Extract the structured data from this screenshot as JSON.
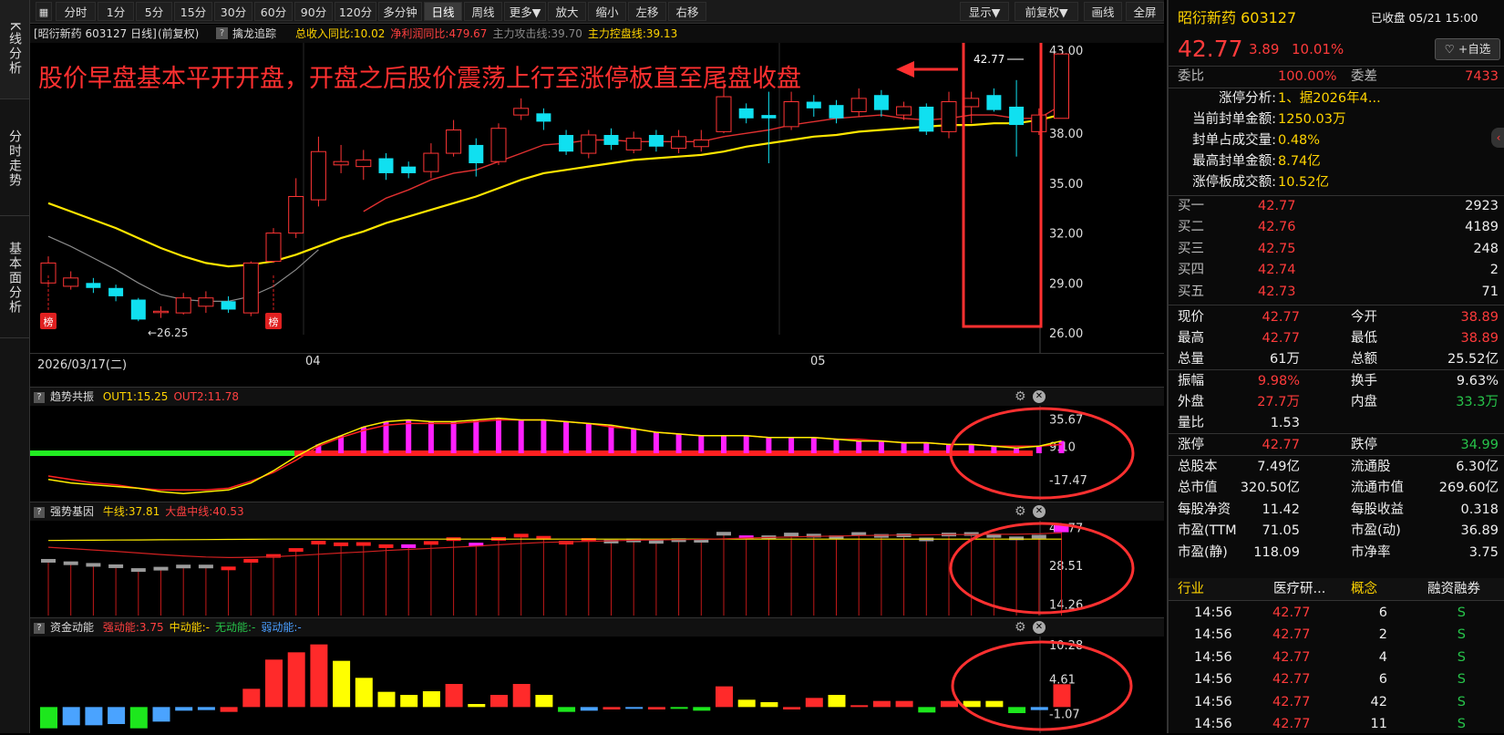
{
  "left_tabs": [
    "K线分析",
    "分时走势",
    "基本面分析"
  ],
  "toolbar": {
    "buttons": [
      "分时",
      "1分",
      "5分",
      "15分",
      "30分",
      "60分",
      "90分",
      "120分",
      "多分钟",
      "日线",
      "周线",
      "更多▼",
      "放大",
      "缩小",
      "左移",
      "右移"
    ],
    "active": "日线",
    "right_buttons": [
      "显示▼",
      "前复权▼",
      "画线",
      "全屏"
    ]
  },
  "infobar": {
    "stock": "[昭衍新药 603127 日线]",
    "adjust": "(前复权)",
    "indicator": "擒龙追踪",
    "items": [
      {
        "text": "总收入同比:10.02",
        "color": "#ffd400"
      },
      {
        "text": "净利润同比:479.67",
        "color": "#ff4040"
      },
      {
        "text": "主力攻击线:39.70",
        "color": "#888888"
      },
      {
        "text": "主力控盘线:39.13",
        "color": "#ffd400"
      }
    ]
  },
  "annotation": {
    "text": "股价早盘基本平开开盘，开盘之后股价震荡上行至涨停板直至尾盘收盘",
    "high_label": "42.77",
    "low_label": "26.25",
    "bang": "榜"
  },
  "main_chart": {
    "y_ticks": [
      "43.00",
      "38.00",
      "35.00",
      "32.00",
      "29.00",
      "26.00"
    ],
    "x_labels": [
      "2026/03/17(二)",
      "04",
      "05"
    ]
  },
  "panel1": {
    "title": "趋势共振",
    "items": [
      {
        "text": "OUT1:15.25",
        "color": "#ffd400"
      },
      {
        "text": "OUT2:11.78",
        "color": "#ff4040"
      }
    ],
    "y_ticks": [
      "35.67",
      "9.10",
      "-17.47"
    ]
  },
  "panel2": {
    "title": "强势基因",
    "items": [
      {
        "text": "牛线:37.81",
        "color": "#ffd400"
      },
      {
        "text": "大盘中线:40.53",
        "color": "#ff4040"
      }
    ],
    "y_ticks": [
      "42.77",
      "28.51",
      "14.26"
    ]
  },
  "panel3": {
    "title": "资金动能",
    "items": [
      {
        "text": "强动能:3.75",
        "color": "#ff4040"
      },
      {
        "text": "中动能:-",
        "color": "#ffd400"
      },
      {
        "text": "无动能:-",
        "color": "#27c44a"
      },
      {
        "text": "弱动能:-",
        "color": "#4a9eff"
      }
    ],
    "y_ticks": [
      "10.28",
      "4.61",
      "-1.07"
    ]
  },
  "quote": {
    "name": "昭衍新药 603127",
    "status": "已收盘 05/21 15:00",
    "price": "42.77",
    "change": "3.89",
    "pct": "10.01%",
    "watch_label": "+自选",
    "webi_label": "委比",
    "webi": "100.00%",
    "weicha_label": "委差",
    "weicha": "7433",
    "limit_analysis": [
      {
        "label": "涨停分析:",
        "value": "1、据2026年4..."
      },
      {
        "label": "当前封单金额:",
        "value": "1250.03万"
      },
      {
        "label": "封单占成交量:",
        "value": "0.48%"
      },
      {
        "label": "最高封单金额:",
        "value": "8.74亿"
      },
      {
        "label": "涨停板成交额:",
        "value": "10.52亿"
      }
    ],
    "bids": [
      {
        "label": "买一",
        "price": "42.77",
        "vol": "2923"
      },
      {
        "label": "买二",
        "price": "42.76",
        "vol": "4189"
      },
      {
        "label": "买三",
        "price": "42.75",
        "vol": "248"
      },
      {
        "label": "买四",
        "price": "42.74",
        "vol": "2"
      },
      {
        "label": "买五",
        "price": "42.73",
        "vol": "71"
      }
    ],
    "stats": [
      {
        "l1": "现价",
        "v1": "42.77",
        "c1": "red",
        "l2": "今开",
        "v2": "38.89",
        "c2": "red"
      },
      {
        "l1": "最高",
        "v1": "42.77",
        "c1": "red",
        "l2": "最低",
        "v2": "38.89",
        "c2": "red"
      },
      {
        "l1": "总量",
        "v1": "61万",
        "c1": "white",
        "l2": "总额",
        "v2": "25.52亿",
        "c2": "white"
      },
      {
        "l1": "振幅",
        "v1": "9.98%",
        "c1": "red",
        "l2": "换手",
        "v2": "9.63%",
        "c2": "white"
      },
      {
        "l1": "外盘",
        "v1": "27.7万",
        "c1": "red",
        "l2": "内盘",
        "v2": "33.3万",
        "c2": "green"
      },
      {
        "l1": "量比",
        "v1": "1.53",
        "c1": "white",
        "l2": "",
        "v2": "",
        "c2": "white"
      },
      {
        "l1": "涨停",
        "v1": "42.77",
        "c1": "red",
        "l2": "跌停",
        "v2": "34.99",
        "c2": "green"
      },
      {
        "l1": "总股本",
        "v1": "7.49亿",
        "c1": "white",
        "l2": "流通股",
        "v2": "6.30亿",
        "c2": "white"
      },
      {
        "l1": "总市值",
        "v1": "320.50亿",
        "c1": "white",
        "l2": "流通市值",
        "v2": "269.60亿",
        "c2": "white"
      },
      {
        "l1": "每股净资",
        "v1": "11.42",
        "c1": "white",
        "l2": "每股收益",
        "v2": "0.318",
        "c2": "white"
      },
      {
        "l1": "市盈(TTM",
        "v1": "71.05",
        "c1": "white",
        "l2": "市盈(动)",
        "v2": "36.89",
        "c2": "white"
      },
      {
        "l1": "市盈(静)",
        "v1": "118.09",
        "c1": "white",
        "l2": "市净率",
        "v2": "3.75",
        "c2": "white"
      }
    ],
    "tags": [
      "行业",
      "医疗研...",
      "概念",
      "融资融券"
    ],
    "ticks": [
      {
        "time": "14:56",
        "price": "42.77",
        "vol": "6",
        "flag": "S"
      },
      {
        "time": "14:56",
        "price": "42.77",
        "vol": "2",
        "flag": "S"
      },
      {
        "time": "14:56",
        "price": "42.77",
        "vol": "4",
        "flag": "S"
      },
      {
        "time": "14:56",
        "price": "42.77",
        "vol": "6",
        "flag": "S"
      },
      {
        "time": "14:56",
        "price": "42.77",
        "vol": "42",
        "flag": "S"
      },
      {
        "time": "14:56",
        "price": "42.77",
        "vol": "11",
        "flag": "S"
      }
    ]
  },
  "chart_data": {
    "type": "candlestick",
    "candles": [
      {
        "o": 29.0,
        "c": 30.2,
        "h": 30.6,
        "l": 28.8
      },
      {
        "o": 28.8,
        "c": 29.3,
        "h": 29.7,
        "l": 28.6
      },
      {
        "o": 29.0,
        "c": 28.7,
        "h": 29.3,
        "l": 28.4
      },
      {
        "o": 28.7,
        "c": 28.2,
        "h": 28.9,
        "l": 27.9
      },
      {
        "o": 28.0,
        "c": 26.8,
        "h": 28.1,
        "l": 26.7
      },
      {
        "o": 27.3,
        "c": 27.3,
        "h": 27.6,
        "l": 26.9
      },
      {
        "o": 27.2,
        "c": 28.1,
        "h": 28.4,
        "l": 27.1
      },
      {
        "o": 27.6,
        "c": 28.1,
        "h": 28.5,
        "l": 27.2
      },
      {
        "o": 27.9,
        "c": 27.4,
        "h": 28.2,
        "l": 27.2
      },
      {
        "o": 27.2,
        "c": 30.2,
        "h": 30.3,
        "l": 27.0
      },
      {
        "o": 30.3,
        "c": 32.0,
        "h": 32.3,
        "l": 30.2
      },
      {
        "o": 32.0,
        "c": 34.2,
        "h": 35.3,
        "l": 31.7
      },
      {
        "o": 34.0,
        "c": 36.9,
        "h": 37.8,
        "l": 33.6
      },
      {
        "o": 36.1,
        "c": 36.3,
        "h": 37.3,
        "l": 35.6
      },
      {
        "o": 36.0,
        "c": 36.4,
        "h": 37.0,
        "l": 35.2
      },
      {
        "o": 36.5,
        "c": 35.6,
        "h": 36.8,
        "l": 35.2
      },
      {
        "o": 36.0,
        "c": 35.6,
        "h": 36.3,
        "l": 35.3
      },
      {
        "o": 35.7,
        "c": 36.8,
        "h": 37.4,
        "l": 35.3
      },
      {
        "o": 36.8,
        "c": 38.2,
        "h": 38.8,
        "l": 36.6
      },
      {
        "o": 37.3,
        "c": 36.2,
        "h": 37.7,
        "l": 35.4
      },
      {
        "o": 36.3,
        "c": 38.3,
        "h": 38.6,
        "l": 36.1
      },
      {
        "o": 39.1,
        "c": 39.5,
        "h": 40.1,
        "l": 38.8
      },
      {
        "o": 39.2,
        "c": 38.7,
        "h": 39.5,
        "l": 38.2
      },
      {
        "o": 37.9,
        "c": 36.9,
        "h": 38.2,
        "l": 36.7
      },
      {
        "o": 36.8,
        "c": 37.9,
        "h": 38.2,
        "l": 36.5
      },
      {
        "o": 37.9,
        "c": 37.3,
        "h": 38.3,
        "l": 37.0
      },
      {
        "o": 37.0,
        "c": 37.7,
        "h": 38.1,
        "l": 36.8
      },
      {
        "o": 37.9,
        "c": 37.2,
        "h": 38.2,
        "l": 36.9
      },
      {
        "o": 37.1,
        "c": 37.8,
        "h": 38.2,
        "l": 36.8
      },
      {
        "o": 37.2,
        "c": 37.6,
        "h": 38.2,
        "l": 36.9
      },
      {
        "o": 38.1,
        "c": 40.2,
        "h": 41.2,
        "l": 38.0
      },
      {
        "o": 39.5,
        "c": 38.9,
        "h": 39.8,
        "l": 38.6
      },
      {
        "o": 39.1,
        "c": 38.9,
        "h": 40.5,
        "l": 36.2
      },
      {
        "o": 38.4,
        "c": 39.9,
        "h": 40.5,
        "l": 38.2
      },
      {
        "o": 39.9,
        "c": 39.5,
        "h": 40.3,
        "l": 39.0
      },
      {
        "o": 39.7,
        "c": 38.9,
        "h": 40.0,
        "l": 38.6
      },
      {
        "o": 39.3,
        "c": 40.1,
        "h": 40.7,
        "l": 39.0
      },
      {
        "o": 40.3,
        "c": 39.4,
        "h": 40.6,
        "l": 39.0
      },
      {
        "o": 39.1,
        "c": 39.6,
        "h": 39.9,
        "l": 38.8
      },
      {
        "o": 39.6,
        "c": 38.1,
        "h": 39.8,
        "l": 37.9
      },
      {
        "o": 38.1,
        "c": 39.9,
        "h": 40.5,
        "l": 37.7
      },
      {
        "o": 39.6,
        "c": 40.1,
        "h": 40.5,
        "l": 38.6
      },
      {
        "o": 40.3,
        "c": 39.4,
        "h": 40.7,
        "l": 39.3
      },
      {
        "o": 39.6,
        "c": 38.5,
        "h": 41.2,
        "l": 36.6
      },
      {
        "o": 38.1,
        "c": 39.1,
        "h": 39.5,
        "l": 37.9
      },
      {
        "o": 38.9,
        "c": 42.77,
        "h": 42.77,
        "l": 38.89
      }
    ],
    "ma_yellow": [
      33.8,
      33.3,
      32.8,
      32.3,
      31.7,
      31.1,
      30.6,
      30.2,
      30.0,
      30.1,
      30.3,
      30.7,
      31.2,
      31.7,
      32.1,
      32.6,
      33.0,
      33.4,
      33.8,
      34.2,
      34.7,
      35.2,
      35.6,
      35.8,
      36.0,
      36.2,
      36.4,
      36.5,
      36.6,
      36.7,
      36.9,
      37.2,
      37.4,
      37.6,
      37.8,
      37.9,
      38.1,
      38.2,
      38.3,
      38.4,
      38.5,
      38.5,
      38.6,
      38.6,
      38.8,
      39.13
    ],
    "ma_red": [
      null,
      null,
      null,
      null,
      null,
      null,
      null,
      null,
      null,
      null,
      null,
      null,
      null,
      null,
      33.3,
      34.1,
      34.6,
      35.2,
      35.6,
      35.8,
      36.3,
      36.8,
      37.3,
      37.4,
      37.6,
      37.6,
      37.5,
      37.5,
      37.5,
      37.5,
      37.8,
      38.0,
      38.2,
      38.5,
      38.7,
      38.9,
      39.0,
      39.1,
      38.9,
      38.8,
      38.9,
      39.1,
      39.1,
      38.9,
      38.9,
      39.7
    ],
    "ma_grey": [
      31.8,
      31.2,
      30.5,
      29.8,
      29.0,
      28.3,
      28.0,
      27.9,
      27.9,
      28.2,
      28.8,
      29.8,
      31.0
    ],
    "panel1_out1": [
      -15,
      -17,
      -18,
      -19,
      -20,
      -22,
      -23,
      -22,
      -21,
      -17,
      -10,
      -2,
      5,
      10,
      15,
      18,
      19,
      18,
      18,
      19,
      20,
      19,
      19,
      18,
      17,
      16,
      14,
      12,
      11,
      10,
      10,
      10,
      9,
      9,
      9,
      8,
      7,
      7,
      6,
      6,
      5,
      5,
      4,
      3,
      4,
      7
    ],
    "panel1_out2": [
      -13,
      -15,
      -17,
      -18,
      -20,
      -21,
      -21,
      -21,
      -20,
      -16,
      -11,
      -4,
      4,
      9,
      13,
      16,
      17,
      17,
      17,
      18,
      19,
      19,
      19,
      18,
      17,
      15,
      14,
      12,
      11,
      10,
      10,
      10,
      9,
      9,
      9,
      8,
      8,
      7,
      6,
      6,
      5,
      5,
      4,
      4,
      4,
      5
    ],
    "panel2_vals": [
      30.2,
      29.3,
      28.7,
      28.2,
      26.8,
      27.3,
      28.1,
      28.1,
      27.4,
      30.2,
      32.0,
      34.2,
      36.9,
      36.3,
      36.4,
      35.6,
      35.6,
      36.8,
      38.2,
      36.2,
      38.3,
      39.5,
      38.7,
      36.9,
      37.9,
      37.3,
      37.7,
      37.2,
      37.8,
      37.6,
      40.2,
      38.9,
      38.9,
      39.9,
      39.5,
      38.9,
      40.1,
      39.4,
      39.6,
      38.1,
      39.9,
      40.1,
      39.4,
      38.5,
      39.1,
      42.77
    ],
    "panel3_vals": [
      -3.5,
      -3.0,
      -3.0,
      -2.8,
      -3.5,
      -2.4,
      -0.6,
      -0.5,
      -0.8,
      3.0,
      7.8,
      9.0,
      10.3,
      7.6,
      4.8,
      2.5,
      2.0,
      2.6,
      3.8,
      0.5,
      2.0,
      3.8,
      2.0,
      -0.8,
      -0.6,
      -0.4,
      -0.3,
      -0.4,
      -0.3,
      -0.6,
      3.4,
      1.2,
      0.8,
      -0.4,
      1.5,
      2.0,
      0.3,
      1.0,
      1.0,
      -0.9,
      1.0,
      1.0,
      1.0,
      -1.0,
      -0.5,
      3.75
    ],
    "panel3_colors": [
      "green",
      "blue",
      "blue",
      "blue",
      "green",
      "blue",
      "blue",
      "blue",
      "red",
      "red",
      "red",
      "red",
      "red",
      "yellow",
      "yellow",
      "yellow",
      "yellow",
      "yellow",
      "red",
      "yellow",
      "red",
      "red",
      "yellow",
      "green",
      "blue",
      "red",
      "blue",
      "red",
      "green",
      "green",
      "red",
      "yellow",
      "yellow",
      "red",
      "red",
      "yellow",
      "red",
      "red",
      "red",
      "green",
      "red",
      "yellow",
      "yellow",
      "green",
      "blue",
      "red"
    ]
  }
}
